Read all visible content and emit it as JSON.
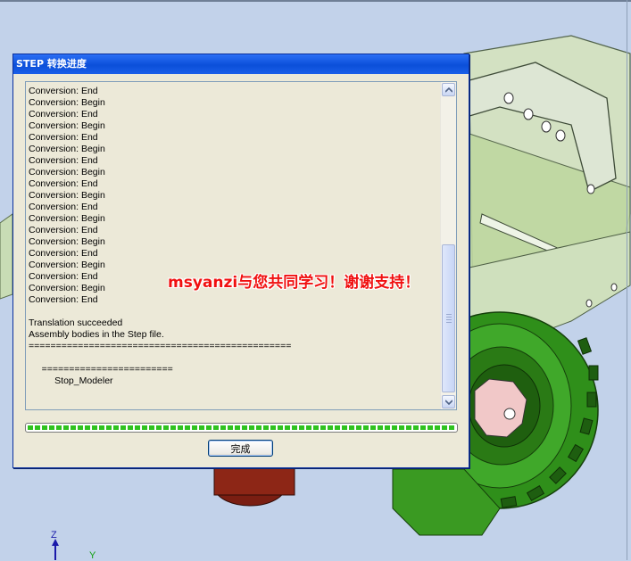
{
  "dialog": {
    "title": "STEP 转换进度",
    "log_lines": [
      "Conversion: End",
      "Conversion: Begin",
      "Conversion: End",
      "Conversion: Begin",
      "Conversion: End",
      "Conversion: Begin",
      "Conversion: End",
      "Conversion: Begin",
      "Conversion: End",
      "Conversion: Begin",
      "Conversion: End",
      "Conversion: Begin",
      "Conversion: End",
      "Conversion: Begin",
      "Conversion: End",
      "Conversion: Begin",
      "Conversion: End",
      "Conversion: Begin",
      "Conversion: End",
      "",
      "Translation succeeded",
      "Assembly bodies in the Step file.",
      "================================================",
      "",
      "     ========================",
      "          Stop_Modeler"
    ],
    "progress": 1.0,
    "ok_label": "完成"
  },
  "overlay": {
    "watermark_text": "msyanzi与您共同学习！谢谢支持！"
  },
  "viewport": {
    "axis_z": "Z",
    "axis_y": "Y"
  },
  "colors": {
    "titlebar": "#0b4fd9",
    "dialog_bg": "#ece9d8",
    "progress_fill": "#2fc21f",
    "watermark": "#f01010",
    "model_green": "#2e8f18",
    "plate_green": "#c4dcaa"
  }
}
